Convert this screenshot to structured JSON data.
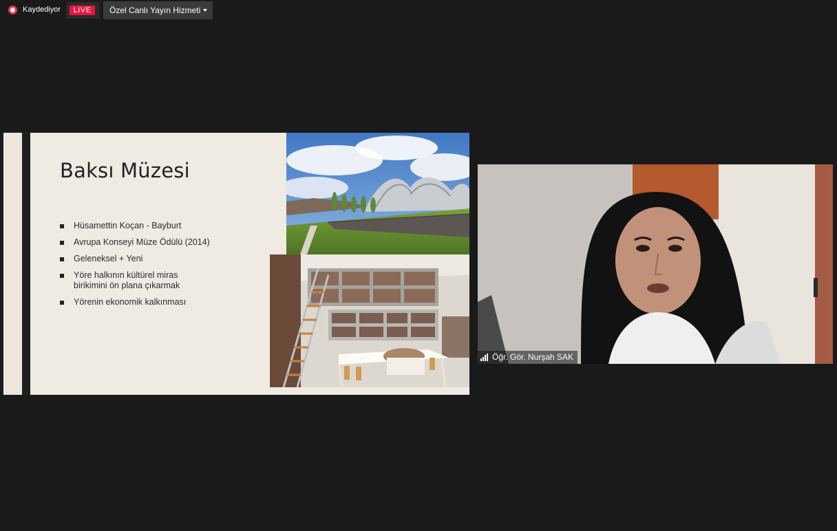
{
  "toolbar": {
    "recording_label": "Kaydediyor",
    "live_label": "LIVE",
    "stream_service_label": "Özel Canlı Yayın Hizmeti"
  },
  "slide": {
    "title": "Baksı Müzesi",
    "bullets": [
      "Hüsamettin Koçan - Bayburt",
      "Avrupa Konseyi Müze Ödülü (2014)",
      "Geleneksel + Yeni",
      "Yöre halkının kültürel miras birikimini ön plana çıkarmak",
      "Yörenin ekonomik kalkınması"
    ]
  },
  "participant": {
    "name": "Öğr. Gör. Nurşah SAK"
  },
  "colors": {
    "background": "#1a1a1a",
    "live": "#e5173f",
    "slide_bg": "#efebe3",
    "record": "#e0394a"
  },
  "icons": [
    "record-icon",
    "caret-down-icon",
    "signal-strength-icon"
  ]
}
